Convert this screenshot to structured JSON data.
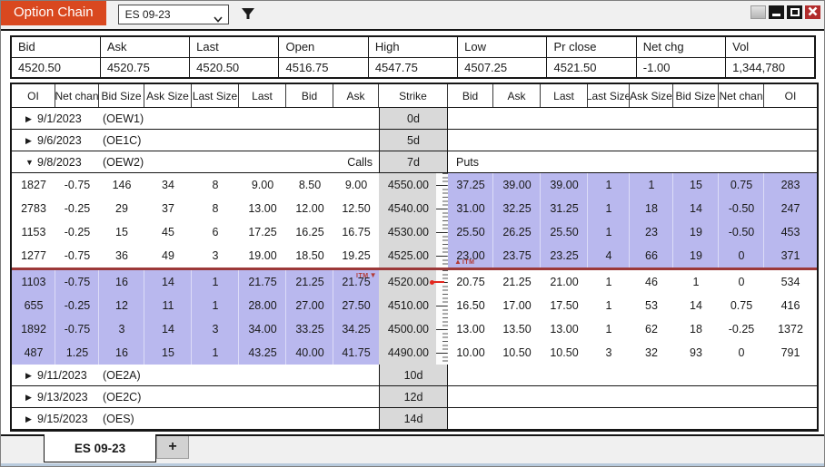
{
  "title_bar": {
    "title": "Option Chain",
    "instrument": "ES 09-23",
    "window_controls": [
      "blank",
      "minimize",
      "maximize",
      "close"
    ]
  },
  "summary": {
    "columns": [
      "Bid",
      "Ask",
      "Last",
      "Open",
      "High",
      "Low",
      "Pr close",
      "Net chg",
      "Vol"
    ],
    "values": [
      "4520.50",
      "4520.75",
      "4520.50",
      "4516.75",
      "4547.75",
      "4507.25",
      "4521.50",
      "-1.00",
      "1,344,780"
    ]
  },
  "chain": {
    "headers": [
      "OI",
      "Net chan",
      "Bid Size",
      "Ask Size",
      "Last Size",
      "Last",
      "Bid",
      "Ask",
      "Strike",
      "Bid",
      "Ask",
      "Last",
      "Last Size",
      "Ask Size",
      "Bid Size",
      "Net chan",
      "OI"
    ],
    "expirations_top": [
      {
        "date": "9/1/2023",
        "code": "(OEW1)",
        "days": "0d",
        "expanded": false
      },
      {
        "date": "9/6/2023",
        "code": "(OE1C)",
        "days": "5d",
        "expanded": false
      },
      {
        "date": "9/8/2023",
        "code": "(OEW2)",
        "days": "7d",
        "expanded": true,
        "calls_label": "Calls",
        "puts_label": "Puts"
      }
    ],
    "rows_above_line": [
      [
        "1827",
        "-0.75",
        "146",
        "34",
        "8",
        "9.00",
        "8.50",
        "9.00",
        "4550.00",
        "37.25",
        "39.00",
        "39.00",
        "1",
        "1",
        "15",
        "0.75",
        "283"
      ],
      [
        "2783",
        "-0.25",
        "29",
        "37",
        "8",
        "13.00",
        "12.00",
        "12.50",
        "4540.00",
        "31.00",
        "32.25",
        "31.25",
        "1",
        "18",
        "14",
        "-0.50",
        "247"
      ],
      [
        "1153",
        "-0.25",
        "15",
        "45",
        "6",
        "17.25",
        "16.25",
        "16.75",
        "4530.00",
        "25.50",
        "26.25",
        "25.50",
        "1",
        "23",
        "19",
        "-0.50",
        "453"
      ],
      [
        "1277",
        "-0.75",
        "36",
        "49",
        "3",
        "19.00",
        "18.50",
        "19.25",
        "4525.00",
        "23.00",
        "23.75",
        "23.25",
        "4",
        "66",
        "19",
        "0",
        "371"
      ]
    ],
    "rows_below_line": [
      [
        "1103",
        "-0.75",
        "16",
        "14",
        "1",
        "21.75",
        "21.25",
        "21.75",
        "4520.00",
        "20.75",
        "21.25",
        "21.00",
        "1",
        "46",
        "1",
        "0",
        "534"
      ],
      [
        "655",
        "-0.25",
        "12",
        "11",
        "1",
        "28.00",
        "27.00",
        "27.50",
        "4510.00",
        "16.50",
        "17.00",
        "17.50",
        "1",
        "53",
        "14",
        "0.75",
        "416"
      ],
      [
        "1892",
        "-0.75",
        "3",
        "14",
        "3",
        "34.00",
        "33.25",
        "34.25",
        "4500.00",
        "13.00",
        "13.50",
        "13.00",
        "1",
        "62",
        "18",
        "-0.25",
        "1372"
      ],
      [
        "487",
        "1.25",
        "16",
        "15",
        "1",
        "43.25",
        "40.00",
        "41.75",
        "4490.00",
        "10.00",
        "10.50",
        "10.50",
        "3",
        "32",
        "93",
        "0",
        "791"
      ]
    ],
    "price_marker_strike": "4520.00",
    "itm_label": "ITM",
    "expirations_bottom": [
      {
        "date": "9/11/2023",
        "code": "(OE2A)",
        "days": "10d",
        "expanded": false
      },
      {
        "date": "9/13/2023",
        "code": "(OE2C)",
        "days": "12d",
        "expanded": false
      },
      {
        "date": "9/15/2023",
        "code": "(OES)",
        "days": "14d",
        "expanded": false
      }
    ]
  },
  "tabs": {
    "active": "ES 09-23",
    "add": "+"
  },
  "icons": {
    "collapsed": "▶",
    "expanded": "▼",
    "triangle_up": "▲",
    "triangle_down": "▼"
  },
  "colors": {
    "accent": "#d9481f",
    "purple": "#b9b8ee",
    "strikegray": "#d9d9d9",
    "linered": "#9c3939",
    "itmred": "#b23b35",
    "pricered": "#e3261d",
    "closered": "#b22c2c"
  }
}
